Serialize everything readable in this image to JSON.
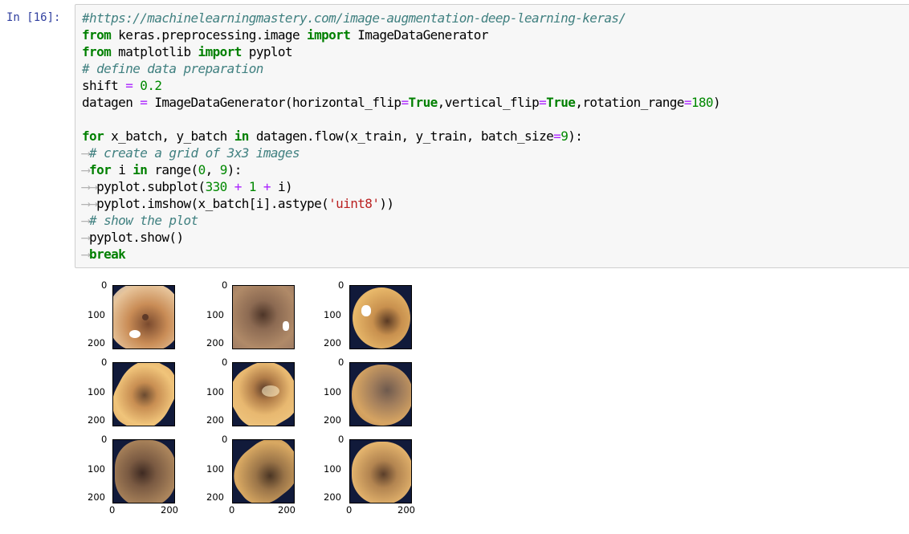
{
  "cell": {
    "prompt": "In [16]:",
    "lines": [
      "#https://machinelearningmastery.com/image-augmentation-deep-learning-keras/",
      "from keras.preprocessing.image import ImageDataGenerator",
      "from matplotlib import pyplot",
      "# define data preparation",
      "shift = 0.2",
      "datagen = ImageDataGenerator(horizontal_flip=True,vertical_flip=True,rotation_range=180)",
      "",
      "for x_batch, y_batch in datagen.flow(x_train, y_train, batch_size=9):",
      "    # create a grid of 3x3 images",
      "    for i in range(0, 9):",
      "        pyplot.subplot(330 + 1 + i)",
      "        pyplot.imshow(x_batch[i].astype('uint8'))",
      "    # show the plot",
      "    pyplot.show()",
      "    break"
    ]
  },
  "output": {
    "y_ticks": [
      "0",
      "100",
      "200"
    ],
    "x_ticks": [
      "0",
      "200"
    ],
    "grid": "3x3"
  }
}
